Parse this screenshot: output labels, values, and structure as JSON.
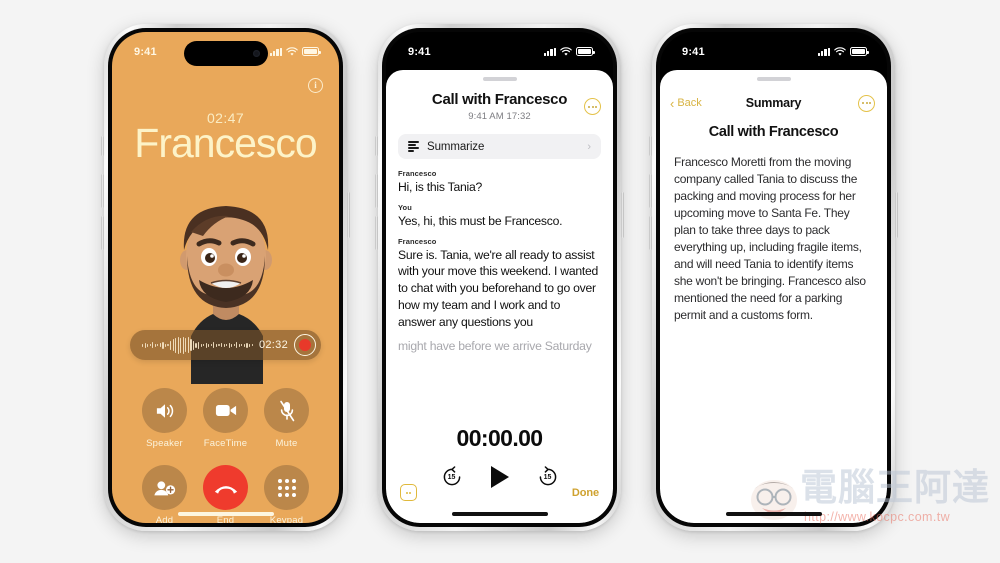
{
  "canvas": {
    "background": "#f4f4f4"
  },
  "phone1": {
    "name": "incoming-call-screen",
    "statusbar": {
      "time": "9:41"
    },
    "call": {
      "timer": "02:47",
      "contact_name": "Francesco",
      "info_icon": "i",
      "recording": {
        "time": "02:32",
        "record_icon": "record-dot"
      },
      "controls": [
        {
          "label": "Speaker",
          "icon": "speaker-icon"
        },
        {
          "label": "FaceTime",
          "icon": "video-camera-icon"
        },
        {
          "label": "Mute",
          "icon": "microphone-muted-icon"
        },
        {
          "label": "Add",
          "icon": "add-person-icon"
        },
        {
          "label": "End",
          "icon": "end-call-icon"
        },
        {
          "label": "Keypad",
          "icon": "keypad-icon"
        }
      ]
    },
    "colors": {
      "bg": "#e9a85a",
      "accent_text": "#fdf3c8",
      "end_red": "#ef3b2d",
      "record_red": "#e8392a"
    }
  },
  "phone2": {
    "name": "call-recording-transcript",
    "statusbar": {
      "time": "9:41"
    },
    "header": {
      "title": "Call with Francesco",
      "subtitle": "9:41 AM  17:32",
      "more_icon": "ellipsis-circle-icon"
    },
    "summarize": {
      "label": "Summarize",
      "icon": "summarize-lines-icon",
      "chevron": "›"
    },
    "transcript": [
      {
        "speaker": "Francesco",
        "text": "Hi, is this Tania?",
        "faded": false
      },
      {
        "speaker": "You",
        "text": "Yes, hi, this must be Francesco.",
        "faded": false
      },
      {
        "speaker": "Francesco",
        "text": "Sure is. Tania, we're all ready to assist with your move this weekend. I wanted to chat with you beforehand to go over how my team and I work and to answer any questions you",
        "faded": false
      },
      {
        "speaker": "",
        "text": "might have before we arrive Saturday",
        "faded": true
      }
    ],
    "player": {
      "elapsed": "00:00.00",
      "skip_back_label": "15",
      "skip_forward_label": "15",
      "play_icon": "play-triangle-icon"
    },
    "footer": {
      "chat_icon": "chat-bubble-icon",
      "done_label": "Done"
    },
    "colors": {
      "accent": "#cfa22f",
      "sheet": "#ffffff"
    }
  },
  "phone3": {
    "name": "call-summary-screen",
    "statusbar": {
      "time": "9:41"
    },
    "nav": {
      "back_label": "Back",
      "title": "Summary",
      "more_icon": "ellipsis-circle-icon"
    },
    "heading": "Call with Francesco",
    "body": "Francesco Moretti from the moving company called Tania to discuss the packing and moving process for her upcoming move to Santa Fe. They plan to take three days to pack everything up, including fragile items, and will need Tania to identify items she won't be bringing. Francesco also mentioned the need for a parking permit and a customs form.",
    "colors": {
      "accent": "#d8b443"
    }
  },
  "watermark": {
    "text": "電腦王阿達",
    "url": "http://www.kocpc.com.tw"
  }
}
